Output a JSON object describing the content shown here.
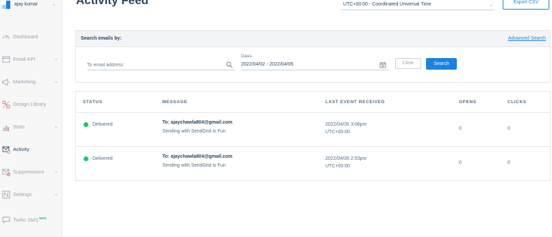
{
  "user": {
    "name": "ajay kumar"
  },
  "sidebar": {
    "items": [
      {
        "label": "Dashboard",
        "icon": "gauge-icon",
        "has_chevron": false
      },
      {
        "label": "Email API",
        "icon": "email-api-icon",
        "has_chevron": true
      },
      {
        "label": "Marketing",
        "icon": "megaphone-icon",
        "has_chevron": true
      },
      {
        "label": "Design Library",
        "icon": "design-library-icon",
        "has_chevron": false
      },
      {
        "label": "Stats",
        "icon": "stats-icon",
        "has_chevron": true
      },
      {
        "label": "Activity",
        "icon": "activity-icon",
        "has_chevron": false,
        "active": true
      },
      {
        "label": "Suppressions",
        "icon": "suppressions-icon",
        "has_chevron": true
      },
      {
        "label": "Settings",
        "icon": "settings-icon",
        "has_chevron": true
      },
      {
        "label": "Twilio SMS",
        "icon": "chat-bubble-icon",
        "has_chevron": false,
        "badge": "NEW"
      }
    ]
  },
  "header": {
    "title": "Activity Feed",
    "timezone": "UTC+00:00 - Coordinated Universal Time",
    "export_label": "Export CSV"
  },
  "search": {
    "title": "Search emails by:",
    "advanced_label": "Advanced Search",
    "email_placeholder": "To email address",
    "dates_label": "Dates",
    "dates_value": "2022/04/02 - 2022/04/05",
    "clear_label": "Clear",
    "search_label": "Search"
  },
  "table": {
    "headers": [
      "STATUS",
      "MESSAGE",
      "LAST EVENT RECEIVED",
      "OPENS",
      "CLICKS"
    ],
    "rows": [
      {
        "status": "Delivered",
        "to": "To: ajaychawla804@gmail.com",
        "subject": "Sending with SendGrid is Fun",
        "time": "2022/04/05 3:06pm",
        "tz": "UTC+00:00",
        "opens": "0",
        "clicks": "0"
      },
      {
        "status": "Delivered",
        "to": "To: ajaychawla804@gmail.com",
        "subject": "Sending with SendGrid is Fun",
        "time": "2022/04/05 2:53pm",
        "tz": "UTC+00:00",
        "opens": "0",
        "clicks": "0"
      }
    ]
  },
  "colors": {
    "accent": "#1a82e2",
    "delivered": "#18c96e",
    "text": "#294661",
    "muted": "#9aa4ae"
  }
}
